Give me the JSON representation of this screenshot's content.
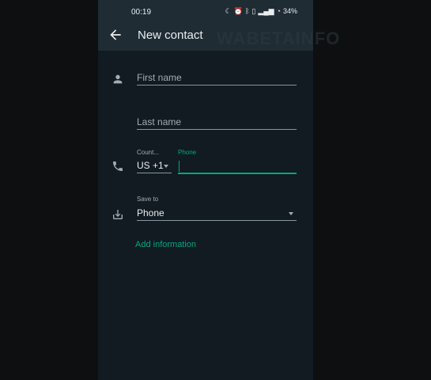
{
  "status_bar": {
    "time": "00:19",
    "battery": "34%"
  },
  "header": {
    "title": "New contact",
    "watermark": "WABETAINFO"
  },
  "form": {
    "first_name_placeholder": "First name",
    "last_name_placeholder": "Last name",
    "country_label": "Count...",
    "country_value": "US +1",
    "phone_label": "Phone",
    "phone_value": "",
    "save_to_label": "Save to",
    "save_to_value": "Phone",
    "add_information": "Add information"
  },
  "colors": {
    "background": "#111b21",
    "topbar": "#1f2c34",
    "accent": "#00a884",
    "text": "#e9edef",
    "muted": "#a3adb3"
  },
  "icons": {
    "back": "arrow-left-icon",
    "person": "person-icon",
    "phone": "phone-icon",
    "save": "download-icon"
  }
}
